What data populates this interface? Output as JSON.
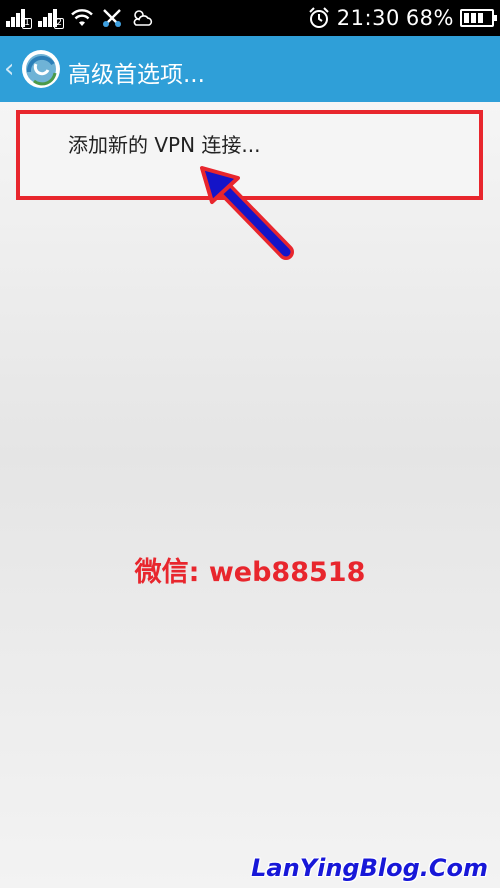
{
  "status_bar": {
    "sim1_label": "1",
    "sim2_label": "2",
    "time": "21:30",
    "battery_percent": "68%",
    "icons": [
      "signal-sim1-icon",
      "signal-sim2-icon",
      "wifi-icon",
      "sync-icon",
      "weather-icon",
      "alarm-icon",
      "battery-icon"
    ]
  },
  "action_bar": {
    "back_glyph": "‹",
    "title": "高级首选项...",
    "color": "#2f9fd8"
  },
  "list": {
    "items": [
      {
        "label": "添加新的 VPN 连接..."
      }
    ]
  },
  "annotations": {
    "highlight_color": "#e8262d",
    "wechat": "微信: web88518",
    "watermark": "LanYingBlog.Com"
  }
}
